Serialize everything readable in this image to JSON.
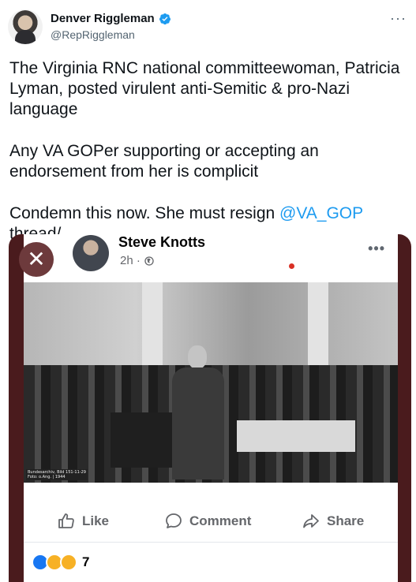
{
  "tweet": {
    "display_name": "Denver Riggleman",
    "handle": "@RepRiggleman",
    "more_icon": "more-horizontal-icon",
    "text_p1": "The Virginia RNC national committeewoman, Patricia Lyman, posted virulent anti-Semitic & pro-Nazi language",
    "text_p2": "Any VA GOPer supporting or accepting an endorsement from her is complicit",
    "text_p3_before": "Condemn this now. She must resign ",
    "text_p3_mention": "@VA_GOP",
    "text_p3_after": " thread/",
    "colors": {
      "mention": "#1d9bf0",
      "verified": "#1d9bf0",
      "text": "#0f1419",
      "secondary": "#536471"
    }
  },
  "facebook_post": {
    "close_glyph": "✕",
    "author": "Steve Knotts",
    "time": "2h ·",
    "more_glyph": "•••",
    "photo_caption_line1": "Bundesarchiv, Bild 151-11-29",
    "photo_caption_line2": "Foto: o.Ang. | 1944",
    "actions": {
      "like": "Like",
      "comment": "Comment",
      "share": "Share"
    },
    "reaction_count": "7",
    "colors": {
      "background_frame": "#4a1b1d",
      "action_text": "#65676b",
      "like_blue": "#1877f2"
    }
  }
}
